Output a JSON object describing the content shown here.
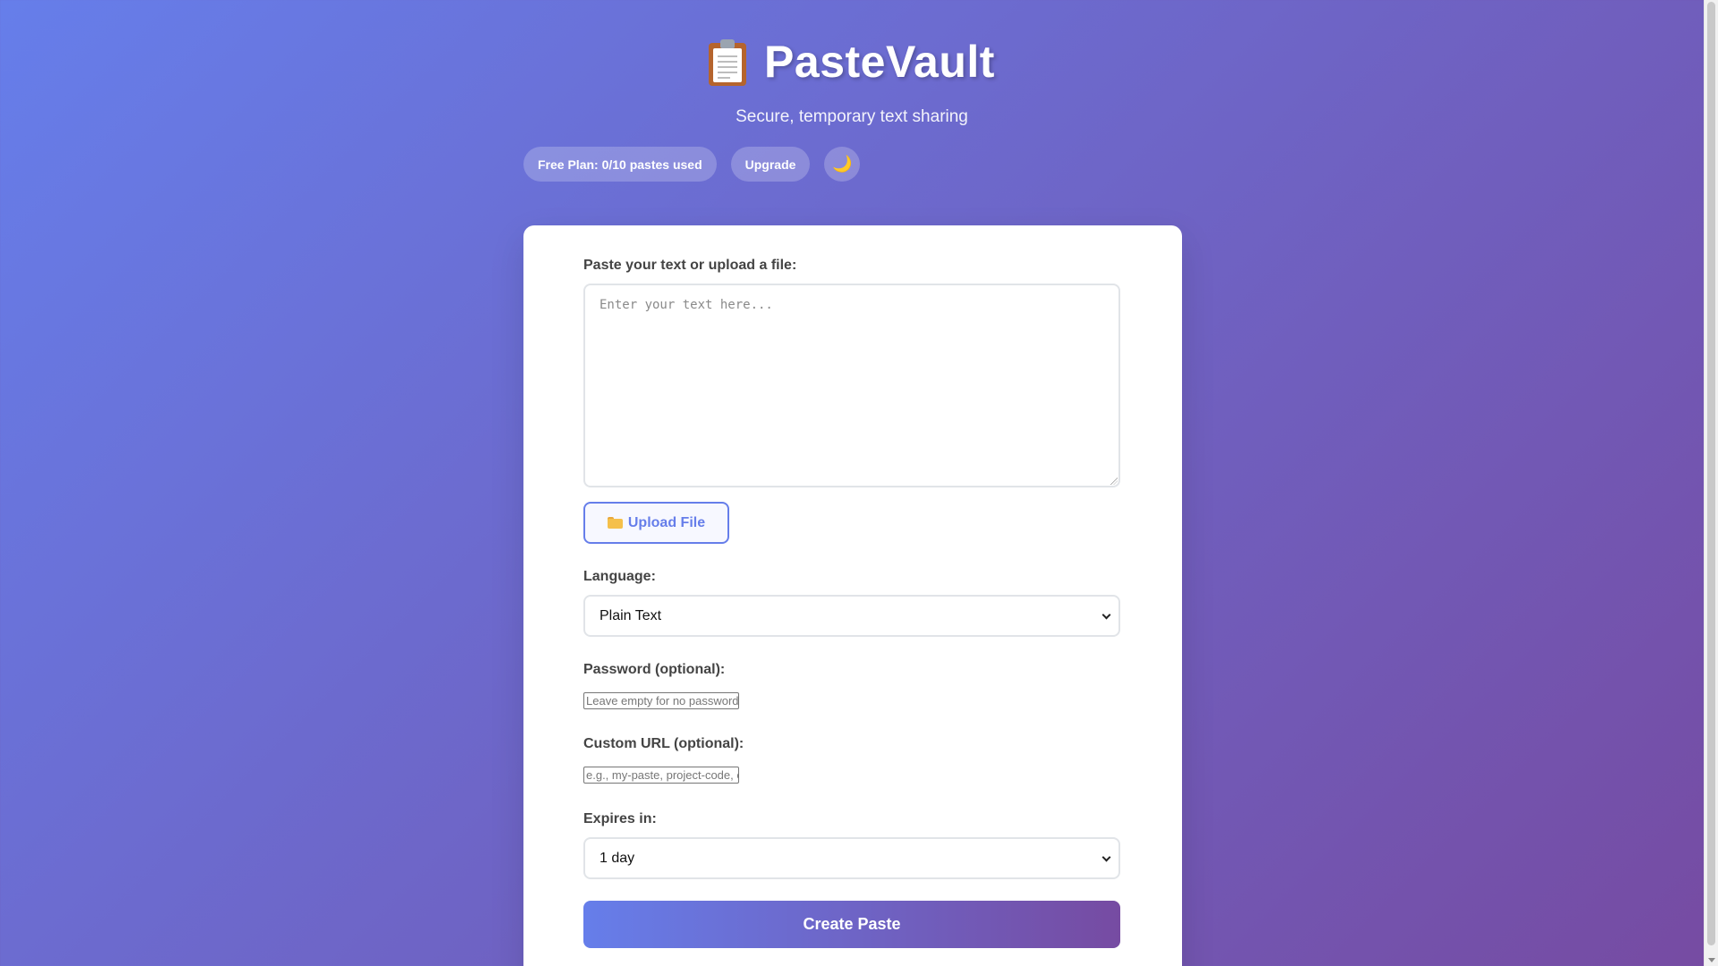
{
  "header": {
    "title": "PasteVault",
    "subtitle": "Secure, temporary text sharing",
    "logo_icon": "clipboard-icon"
  },
  "status": {
    "plan_label": "Free Plan: 0/10 pastes used",
    "upgrade_label": "Upgrade",
    "theme_toggle_icon": "moon-icon",
    "theme_toggle_glyph": "🌙"
  },
  "form": {
    "content_label": "Paste your text or upload a file:",
    "content_placeholder": "Enter your text here...",
    "upload_label": "Upload File",
    "upload_icon": "folder-icon",
    "language_label": "Language:",
    "language_value": "Plain Text",
    "password_label": "Password (optional):",
    "password_placeholder": "Leave empty for no password",
    "custom_url_label": "Custom URL (optional):",
    "custom_url_placeholder": "e.g., my-paste, project-code, etc.",
    "expires_label": "Expires in:",
    "expires_value": "1 day",
    "submit_label": "Create Paste"
  },
  "colors": {
    "gradient_start": "#667eea",
    "gradient_end": "#764ba2",
    "card_background": "#ffffff"
  }
}
